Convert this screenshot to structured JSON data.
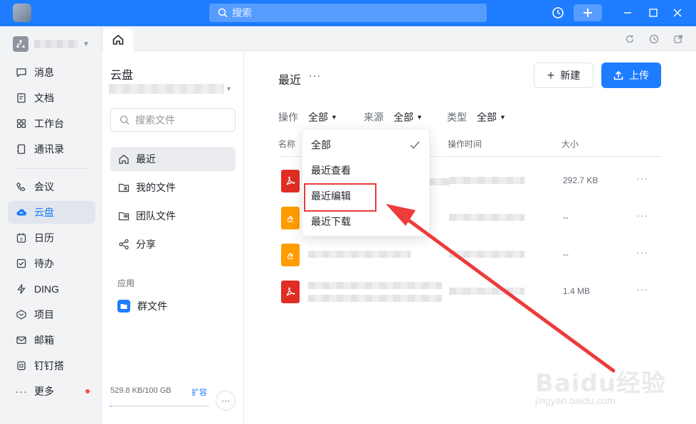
{
  "titlebar": {
    "search_placeholder": "搜索"
  },
  "leftnav": {
    "items": [
      {
        "label": "消息",
        "icon": "message-icon"
      },
      {
        "label": "文档",
        "icon": "document-icon"
      },
      {
        "label": "工作台",
        "icon": "workbench-icon"
      },
      {
        "label": "通讯录",
        "icon": "contacts-icon"
      },
      {
        "label": "会议",
        "icon": "phone-icon"
      },
      {
        "label": "云盘",
        "icon": "cloud-icon",
        "active": true
      },
      {
        "label": "日历",
        "icon": "calendar-icon"
      },
      {
        "label": "待办",
        "icon": "todo-icon"
      },
      {
        "label": "DING",
        "icon": "lightning-icon"
      },
      {
        "label": "项目",
        "icon": "project-icon"
      },
      {
        "label": "邮箱",
        "icon": "mail-icon"
      },
      {
        "label": "钉钉搭",
        "icon": "builder-icon"
      },
      {
        "label": "更多",
        "icon": "more-icon",
        "badge": true
      }
    ]
  },
  "drive": {
    "title": "云盘",
    "search_placeholder": "搜索文件",
    "items": [
      {
        "label": "最近",
        "active": true
      },
      {
        "label": "我的文件"
      },
      {
        "label": "团队文件"
      },
      {
        "label": "分享"
      }
    ],
    "apps_section": "应用",
    "apps": [
      {
        "label": "群文件"
      }
    ],
    "storage": "529.8 KB/100 GB",
    "expand_label": "扩容",
    "accent_color": "#1e7cff"
  },
  "main": {
    "title": "最近",
    "new_button": "新建",
    "upload_button": "上传",
    "filters": [
      {
        "label": "操作",
        "value": "全部"
      },
      {
        "label": "来源",
        "value": "全部"
      },
      {
        "label": "类型",
        "value": "全部"
      }
    ],
    "columns": {
      "name": "名称",
      "time": "操作时间",
      "size": "大小"
    },
    "rows": [
      {
        "type": "pdf",
        "size": "292.7 KB"
      },
      {
        "type": "doc",
        "size": "--"
      },
      {
        "type": "doc",
        "size": "--"
      },
      {
        "type": "pdf",
        "size": "1.4 MB"
      }
    ]
  },
  "dropdown": {
    "items": [
      {
        "label": "全部",
        "selected": true
      },
      {
        "label": "最近查看"
      },
      {
        "label": "最近编辑",
        "highlighted": true
      },
      {
        "label": "最近下载"
      }
    ]
  }
}
